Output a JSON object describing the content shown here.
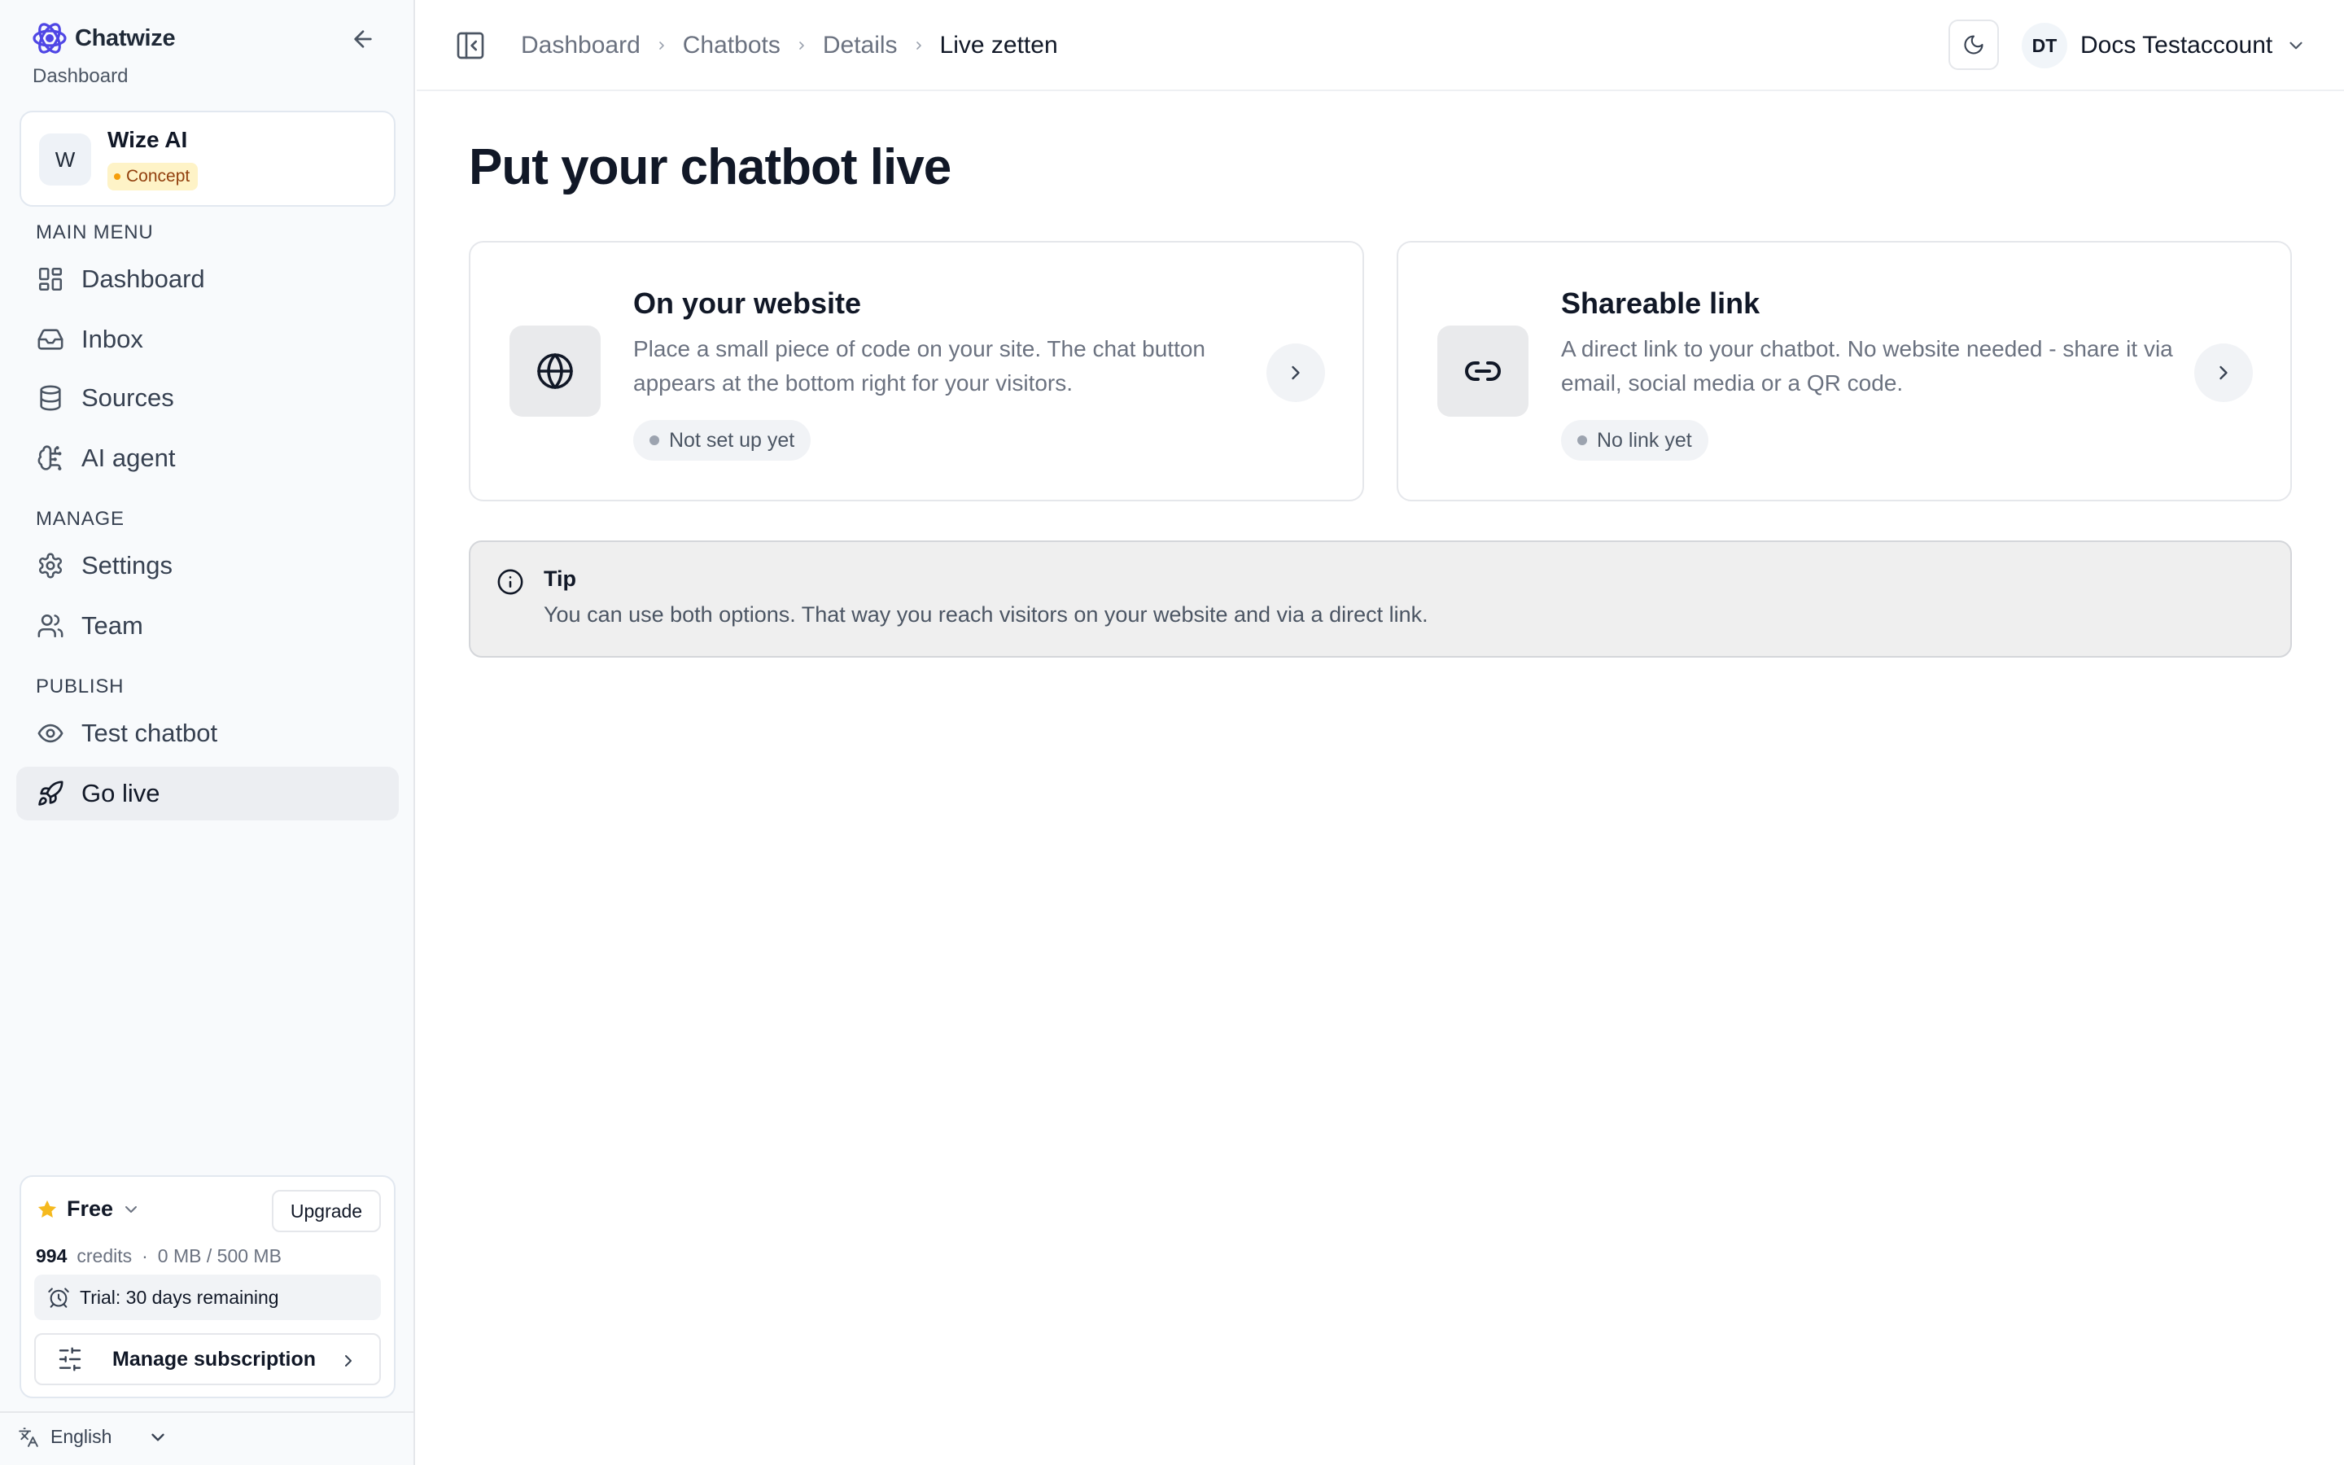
{
  "sidebar": {
    "brand": "Chatwize",
    "brand_sub": "Dashboard",
    "bot": {
      "avatar": "W",
      "name": "Wize AI",
      "status": "Concept"
    },
    "sections": {
      "main": "MAIN MENU",
      "manage": "MANAGE",
      "publish": "PUBLISH"
    },
    "items": [
      {
        "label": "Dashboard",
        "icon": "layout-grid-icon"
      },
      {
        "label": "Inbox",
        "icon": "inbox-icon"
      },
      {
        "label": "Sources",
        "icon": "database-icon"
      },
      {
        "label": "AI agent",
        "icon": "brain-icon"
      },
      {
        "label": "Settings",
        "icon": "gear-icon"
      },
      {
        "label": "Team",
        "icon": "users-icon"
      },
      {
        "label": "Test chatbot",
        "icon": "eye-icon"
      },
      {
        "label": "Go live",
        "icon": "rocket-icon",
        "active": true
      }
    ],
    "plan": {
      "name": "Free",
      "upgrade_label": "Upgrade",
      "credits_value": "994",
      "credits_label": "credits",
      "separator": "·",
      "storage": "0 MB / 500 MB",
      "trial": "Trial: 30 days remaining",
      "manage_label": "Manage subscription"
    },
    "language": "English"
  },
  "topbar": {
    "breadcrumb": [
      "Dashboard",
      "Chatbots",
      "Details",
      "Live zetten"
    ],
    "user": {
      "initials": "DT",
      "name": "Docs Testaccount"
    }
  },
  "main": {
    "title": "Put your chatbot live",
    "options": [
      {
        "title": "On your website",
        "description": "Place a small piece of code on your site. The chat button appears at the bottom right for your visitors.",
        "status": "Not set up yet",
        "icon": "globe-icon"
      },
      {
        "title": "Shareable link",
        "description": "A direct link to your chatbot. No website needed - share it via email, social media or a QR code.",
        "status": "No link yet",
        "icon": "link-icon"
      }
    ],
    "tip": {
      "title": "Tip",
      "text": "You can use both options. That way you reach visitors on your website and via a direct link."
    }
  },
  "colors": {
    "accent": "#4f46e5",
    "concept_badge_bg": "#fef3c7",
    "concept_badge_text": "#92400e",
    "star": "#f5b91e",
    "sidebar_bg": "#f8fafc",
    "tip_bg": "#efefef"
  }
}
